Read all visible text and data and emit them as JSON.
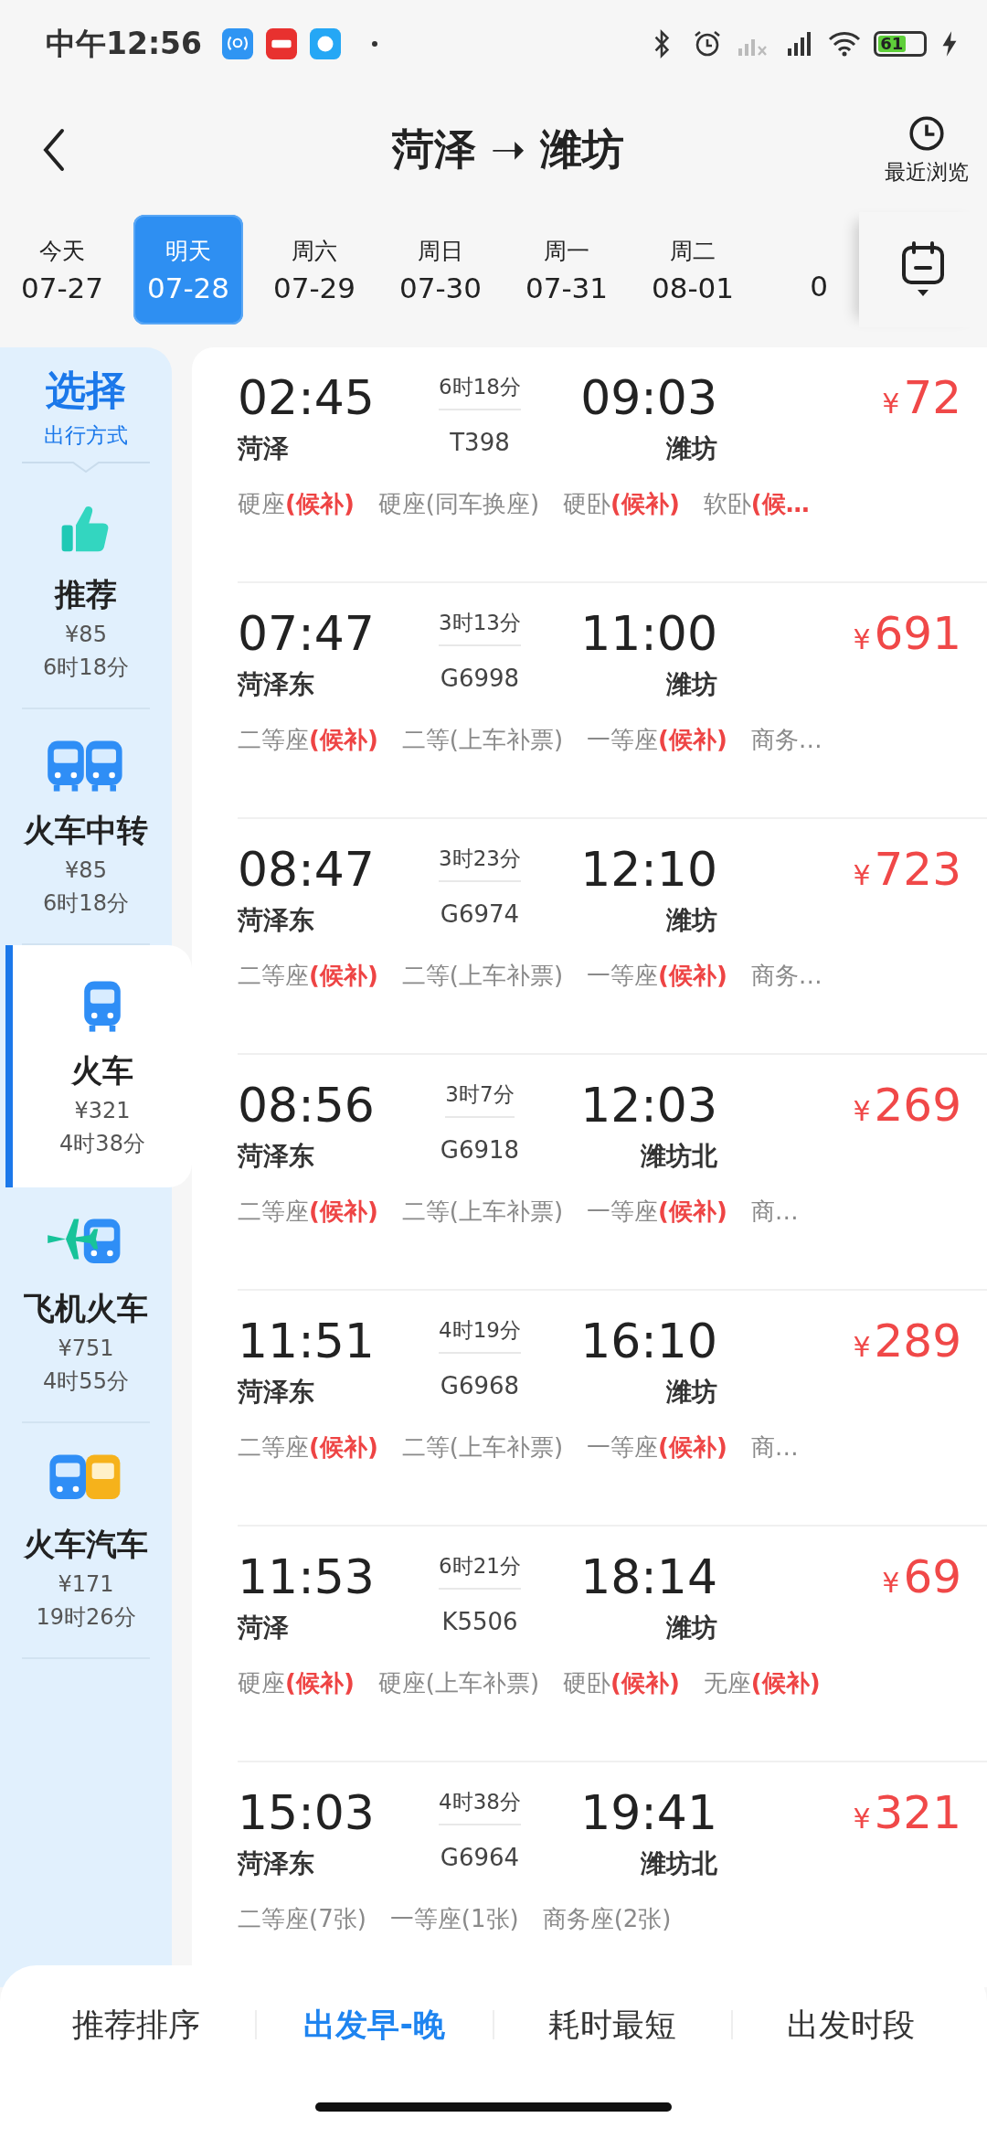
{
  "status_bar": {
    "time": "中午12:56",
    "battery": "61"
  },
  "header": {
    "from": "菏泽",
    "arrow": "➝",
    "to": "潍坊",
    "recent": "最近浏览"
  },
  "dates": [
    {
      "day": "今天",
      "date": "07-27",
      "selected": false
    },
    {
      "day": "明天",
      "date": "07-28",
      "selected": true
    },
    {
      "day": "周六",
      "date": "07-29",
      "selected": false
    },
    {
      "day": "周日",
      "date": "07-30",
      "selected": false
    },
    {
      "day": "周一",
      "date": "07-31",
      "selected": false
    },
    {
      "day": "周二",
      "date": "08-01",
      "selected": false
    },
    {
      "date": "0",
      "selected": false
    }
  ],
  "sidebar": {
    "title": "选择",
    "subtitle": "出行方式",
    "modes": [
      {
        "kind": "recommend",
        "name": "推荐",
        "price": "¥85",
        "duration": "6时18分",
        "selected": false
      },
      {
        "kind": "transfer",
        "name": "火车中转",
        "price": "¥85",
        "duration": "6时18分",
        "selected": false
      },
      {
        "kind": "train",
        "name": "火车",
        "price": "¥321",
        "duration": "4时38分",
        "selected": true
      },
      {
        "kind": "plane_train",
        "name": "飞机火车",
        "price": "¥751",
        "duration": "4时55分",
        "selected": false
      },
      {
        "kind": "train_bus",
        "name": "火车汽车",
        "price": "¥171",
        "duration": "19时26分",
        "selected": false
      }
    ]
  },
  "trains": [
    {
      "depart": "02:45",
      "from": "菏泽",
      "duration": "6时18分",
      "number": "T398",
      "arrive": "09:03",
      "to": "潍坊",
      "price": "72",
      "seats": [
        {
          "name": "硬座",
          "tag": "(候补)"
        },
        {
          "name": "硬座(同车换座)"
        },
        {
          "name": "硬卧",
          "tag": "(候补)"
        },
        {
          "name": "软卧",
          "tag": "(候…"
        }
      ]
    },
    {
      "depart": "07:47",
      "from": "菏泽东",
      "duration": "3时13分",
      "number": "G6998",
      "arrive": "11:00",
      "to": "潍坊",
      "price": "691",
      "seats": [
        {
          "name": "二等座",
          "tag": "(候补)"
        },
        {
          "name": "二等(上车补票)"
        },
        {
          "name": "一等座",
          "tag": "(候补)"
        },
        {
          "name": "商务…"
        }
      ]
    },
    {
      "depart": "08:47",
      "from": "菏泽东",
      "duration": "3时23分",
      "number": "G6974",
      "arrive": "12:10",
      "to": "潍坊",
      "price": "723",
      "seats": [
        {
          "name": "二等座",
          "tag": "(候补)"
        },
        {
          "name": "二等(上车补票)"
        },
        {
          "name": "一等座",
          "tag": "(候补)"
        },
        {
          "name": "商务…"
        }
      ]
    },
    {
      "depart": "08:56",
      "from": "菏泽东",
      "duration": "3时7分",
      "number": "G6918",
      "arrive": "12:03",
      "to": "潍坊北",
      "price": "269",
      "seats": [
        {
          "name": "二等座",
          "tag": "(候补)"
        },
        {
          "name": "二等(上车补票)"
        },
        {
          "name": "一等座",
          "tag": "(候补)"
        },
        {
          "name": "商…"
        }
      ]
    },
    {
      "depart": "11:51",
      "from": "菏泽东",
      "duration": "4时19分",
      "number": "G6968",
      "arrive": "16:10",
      "to": "潍坊",
      "price": "289",
      "seats": [
        {
          "name": "二等座",
          "tag": "(候补)"
        },
        {
          "name": "二等(上车补票)"
        },
        {
          "name": "一等座",
          "tag": "(候补)"
        },
        {
          "name": "商…"
        }
      ]
    },
    {
      "depart": "11:53",
      "from": "菏泽",
      "duration": "6时21分",
      "number": "K5506",
      "arrive": "18:14",
      "to": "潍坊",
      "price": "69",
      "seats": [
        {
          "name": "硬座",
          "tag": "(候补)"
        },
        {
          "name": "硬座(上车补票)"
        },
        {
          "name": "硬卧",
          "tag": "(候补)"
        },
        {
          "name": "无座",
          "tag": "(候补)"
        }
      ]
    },
    {
      "depart": "15:03",
      "from": "菏泽东",
      "duration": "4时38分",
      "number": "G6964",
      "arrive": "19:41",
      "to": "潍坊北",
      "price": "321",
      "seats": [
        {
          "name": "二等座(7张)"
        },
        {
          "name": "一等座(1张)"
        },
        {
          "name": "商务座(2张)"
        }
      ]
    }
  ],
  "currency": "¥",
  "sort_tabs": [
    {
      "label": "推荐排序",
      "selected": false
    },
    {
      "label": "出发早-晚",
      "selected": true
    },
    {
      "label": "耗时最短",
      "selected": false
    },
    {
      "label": "出发时段",
      "selected": false
    }
  ]
}
